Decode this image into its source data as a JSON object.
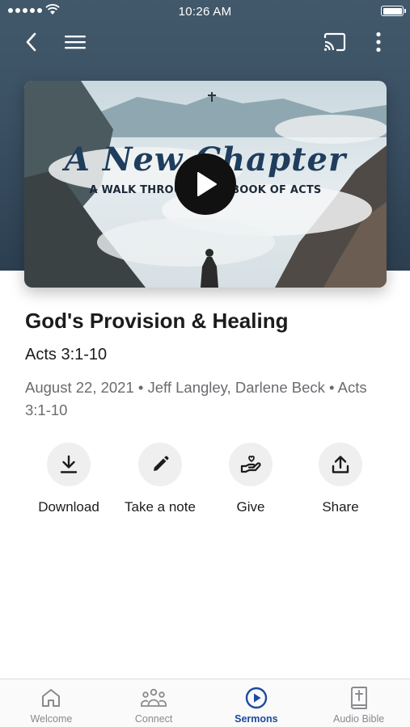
{
  "status_bar": {
    "time": "10:26 AM"
  },
  "nav": {
    "back_icon": "chevron-left-icon",
    "menu_icon": "hamburger-menu-icon",
    "cast_icon": "cast-icon",
    "more_icon": "more-vertical-icon"
  },
  "hero": {
    "title": "A New Chapter",
    "subtitle": "A WALK THROUGH THE BOOK OF ACTS",
    "play_icon": "play-icon"
  },
  "sermon": {
    "title": "God's Provision & Healing",
    "scripture": "Acts 3:1-10",
    "meta": "August 22, 2021 • Jeff Langley, Darlene Beck • Acts 3:1-10"
  },
  "actions": [
    {
      "label": "Download",
      "icon": "download-icon"
    },
    {
      "label": "Take a note",
      "icon": "pencil-icon"
    },
    {
      "label": "Give",
      "icon": "give-hand-heart-icon"
    },
    {
      "label": "Share",
      "icon": "share-icon"
    }
  ],
  "tabs": [
    {
      "label": "Welcome",
      "icon": "home-icon",
      "active": false
    },
    {
      "label": "Connect",
      "icon": "people-icon",
      "active": false
    },
    {
      "label": "Sermons",
      "icon": "play-circle-icon",
      "active": true
    },
    {
      "label": "Audio Bible",
      "icon": "bible-icon",
      "active": false
    }
  ],
  "colors": {
    "header": "#3a5063",
    "accent": "#1d4aa1",
    "action_circle": "#efefef",
    "meta_text": "#6b6b70"
  }
}
